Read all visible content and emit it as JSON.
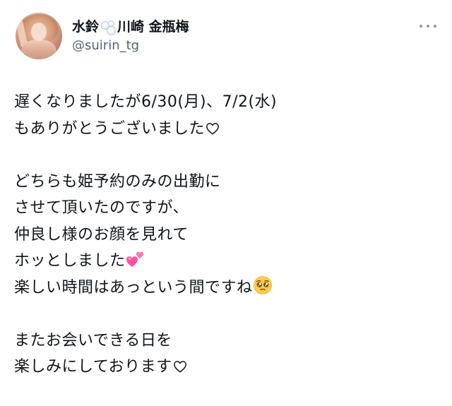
{
  "author": {
    "display_name_part1": "水鈴",
    "display_name_part2": "川崎 金瓶梅",
    "handle": "@suirin_tg",
    "name_emoji": "bubbles-icon"
  },
  "more_menu": {
    "icon": "more-dots-icon"
  },
  "tweet": {
    "lines": [
      "遅くなりましたが6/30(月)、7/2(水)",
      "もありがとうございました",
      "",
      "どちらも姫予約のみの出勤に",
      "させて頂いたのですが、",
      "仲良し様のお顔を見れて",
      "ホッとしました",
      "楽しい時間はあっという間ですね",
      "",
      "またお会いできる日を",
      "楽しみにしております"
    ],
    "emojis": {
      "line2": "heart-outline-icon",
      "line7": "two-hearts-icon",
      "line8": "pleading-face-icon",
      "line11": "heart-outline-icon"
    },
    "colors": {
      "text": "#0f1419",
      "handle": "#536471",
      "pink": "#ff4fa0"
    }
  }
}
